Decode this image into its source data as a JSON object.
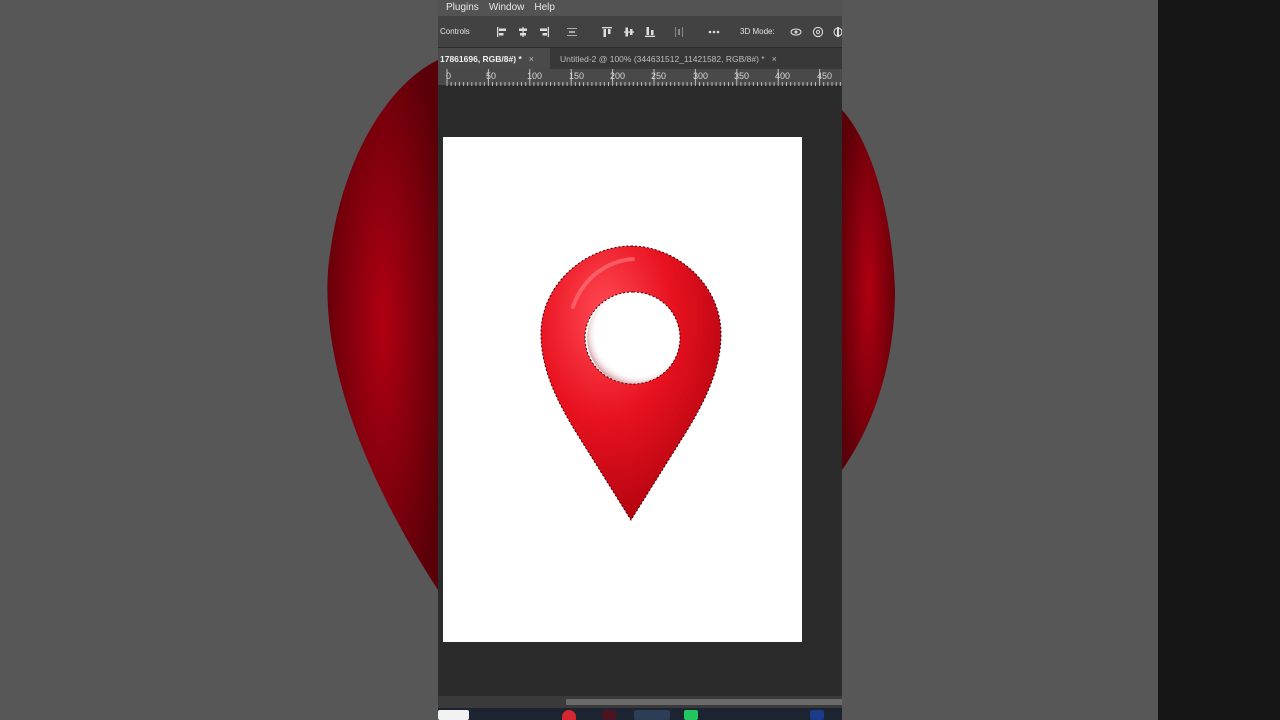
{
  "menu": [
    "Plugins",
    "Window",
    "Help"
  ],
  "options_bar": {
    "controls_label": "Controls",
    "mode_label": "3D Mode:",
    "tools": [
      "align-left-icon",
      "align-center-horizontal-icon",
      "align-right-icon",
      "distribute-horizontal-icon",
      "align-top-icon",
      "align-middle-vertical-icon",
      "align-bottom-icon",
      "distribute-vertical-icon",
      "more-options-icon",
      "3d-orbit-icon",
      "3d-roll-icon",
      "3d-pan-icon"
    ]
  },
  "tabs": [
    {
      "label": "17861696, RGB/8#) *",
      "active": true
    },
    {
      "label": "Untitled-2 @ 100% (344631512_11421582, RGB/8#) *",
      "active": false
    }
  ],
  "tab_close_glyph": "×",
  "ruler": [
    "0",
    "50",
    "100",
    "150",
    "200",
    "250",
    "300",
    "350",
    "400",
    "450"
  ],
  "canvas": {
    "background": "#ffffff",
    "content": "red-location-pin-icon",
    "pin_color": "#e8121f"
  },
  "colors": {
    "workspace": "#2b2b2b",
    "menubar": "#535353",
    "pin_red": "#e8121f"
  }
}
